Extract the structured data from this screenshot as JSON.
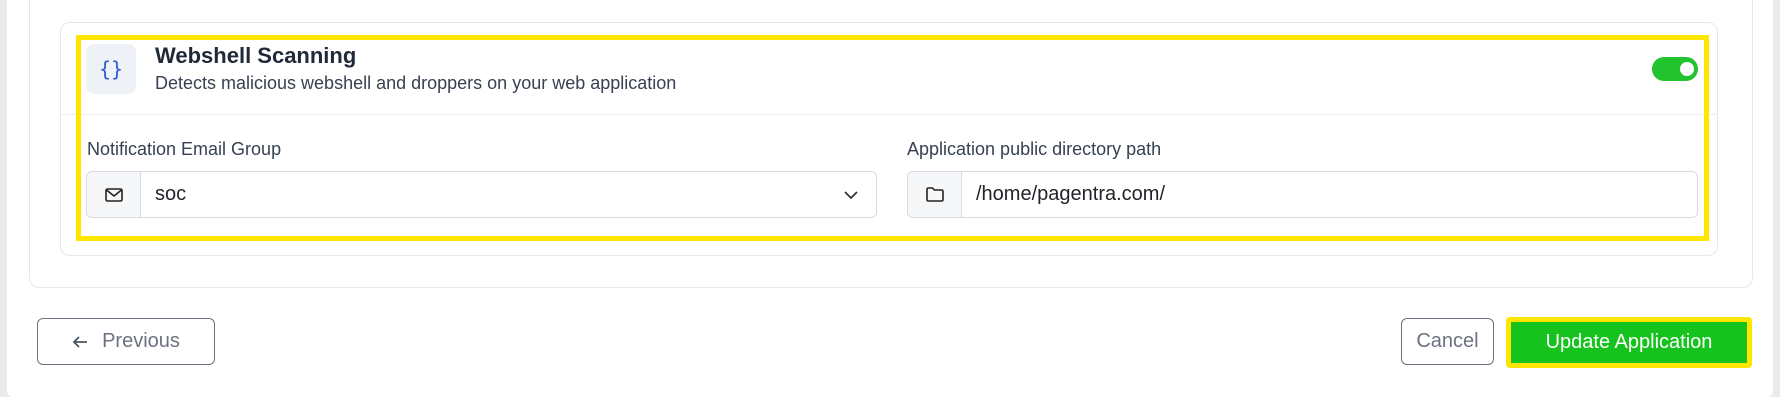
{
  "feature": {
    "icon": "code-braces-icon",
    "icon_glyph": "{}",
    "title": "Webshell Scanning",
    "description": "Detects malicious webshell and droppers on your web application",
    "enabled": true
  },
  "notification": {
    "label": "Notification Email Group",
    "icon": "mail-icon",
    "value": "soc"
  },
  "directory": {
    "label": "Application public directory path",
    "icon": "folder-icon",
    "value": "/home/pagentra.com/"
  },
  "actions": {
    "previous_label": "Previous",
    "cancel_label": "Cancel",
    "update_label": "Update Application"
  },
  "colors": {
    "accent_green": "#16c21d",
    "highlight_yellow": "#ffe600"
  }
}
